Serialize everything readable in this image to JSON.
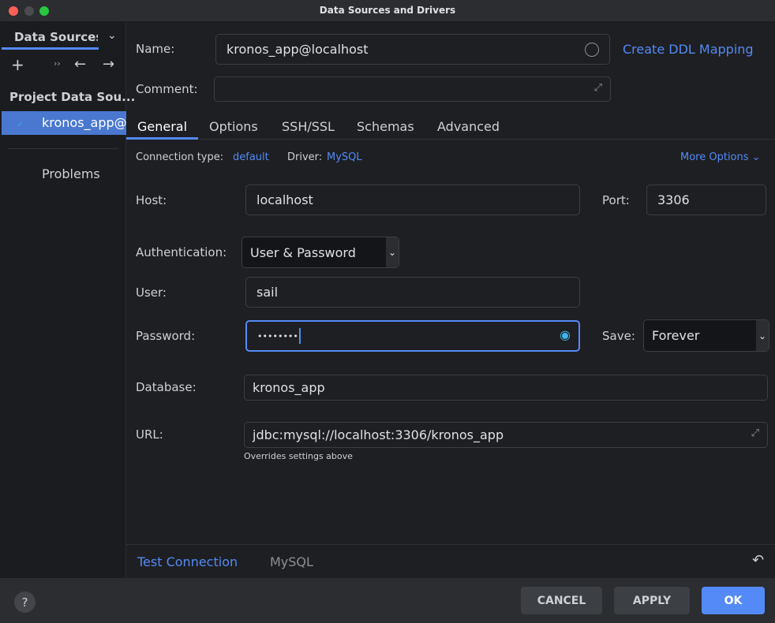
{
  "window": {
    "title": "Data Sources and Drivers"
  },
  "sidebar": {
    "tab_label": "Data Sources",
    "group_label": "Project Data Sou...",
    "items": [
      {
        "label": "kronos_app@localhost"
      }
    ],
    "problems_label": "Problems"
  },
  "form": {
    "name_label": "Name:",
    "name_value": "kronos_app@localhost",
    "create_ddl_label": "Create DDL Mapping",
    "comment_label": "Comment:",
    "comment_value": "",
    "tabs": [
      {
        "label": "General"
      },
      {
        "label": "Options"
      },
      {
        "label": "SSH/SSL"
      },
      {
        "label": "Schemas"
      },
      {
        "label": "Advanced"
      }
    ],
    "connection_type_label": "Connection type:",
    "connection_type_value": "default",
    "driver_label": "Driver:",
    "driver_value": "MySQL",
    "more_options_label": "More Options",
    "host_label": "Host:",
    "host_value": "localhost",
    "port_label": "Port:",
    "port_value": "3306",
    "auth_label": "Authentication:",
    "auth_value": "User & Password",
    "user_label": "User:",
    "user_value": "sail",
    "password_label": "Password:",
    "password_value": "••••••••",
    "save_label": "Save:",
    "save_value": "Forever",
    "database_label": "Database:",
    "database_value": "kronos_app",
    "url_label": "URL:",
    "url_value": "jdbc:mysql://localhost:3306/kronos_app",
    "url_hint": "Overrides settings above"
  },
  "footer": {
    "test_connection": "Test Connection",
    "driver_name": "MySQL",
    "help": "?",
    "cancel": "CANCEL",
    "apply": "APPLY",
    "ok": "OK"
  },
  "colors": {
    "accent": "#548af7",
    "selection": "#4a78d0"
  }
}
